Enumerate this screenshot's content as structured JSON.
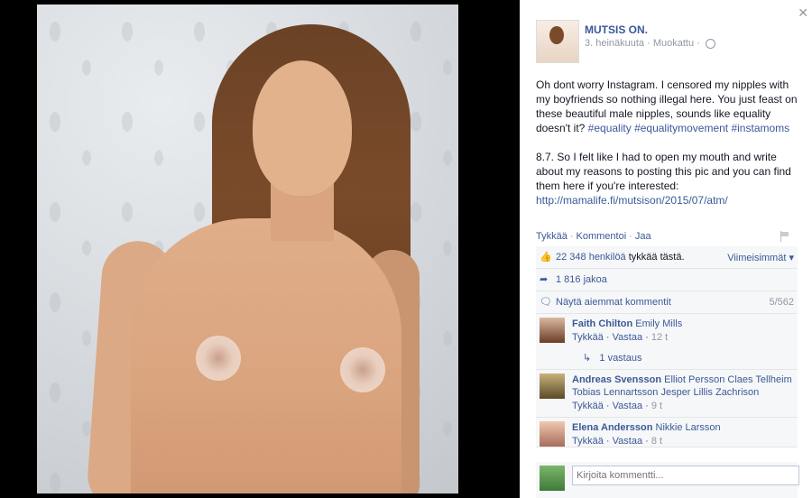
{
  "post": {
    "page_name": "MUTSIS ON.",
    "date": "3. heinäkuuta",
    "edited": "Muokattu",
    "paragraph1_text": "Oh dont worry Instagram. I censored my nipples with my boyfriends so nothing illegal here. You just feast on these beautiful male nipples, sounds like equality doesn't it? ",
    "hashtags": [
      "#equality",
      "#equalitymovement",
      "#instamoms"
    ],
    "paragraph2_text": "8.7. So I felt like I had to open my mouth and write about my reasons to posting this pic and you can find them here if you're interested: ",
    "link": "http://mamalife.fi/mutsison/2015/07/atm/"
  },
  "actions": {
    "like": "Tykkää",
    "comment": "Kommentoi",
    "share": "Jaa"
  },
  "ufi": {
    "likes_count": "22 348 henkilöä",
    "likes_suffix": " tykkää tästä.",
    "sort_label": "Viimeisimmät",
    "shares": "1 816 jakoa",
    "show_previous": "Näytä aiemmat kommentit",
    "comment_count": "5/562"
  },
  "comments": [
    {
      "author": "Faith Chilton",
      "text": "Emily Mills",
      "like": "Tykkää",
      "reply": "Vastaa",
      "time": "12 t",
      "replies": "1 vastaus"
    },
    {
      "author": "Andreas Svensson",
      "text": "Elliot Persson Claes Tellheim Tobias Lennartsson Jesper Lillis Zachrison",
      "like": "Tykkää",
      "reply": "Vastaa",
      "time": "9 t"
    },
    {
      "author": "Elena Andersson",
      "text": "Nikkie Larsson",
      "like": "Tykkää",
      "reply": "Vastaa",
      "time": "8 t"
    }
  ],
  "composer": {
    "placeholder": "Kirjoita kommentti..."
  },
  "colors": {
    "link": "#3b5998",
    "muted": "#9197a3",
    "ufi_bg": "#f6f7f8"
  }
}
